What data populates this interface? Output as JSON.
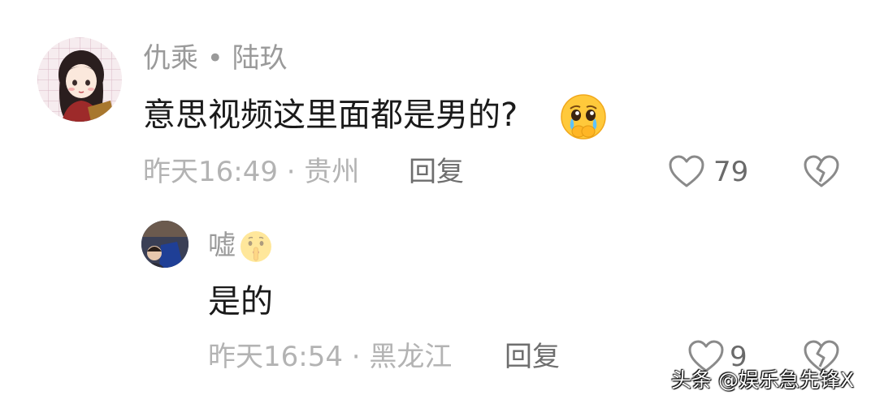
{
  "comment": {
    "author": "仇乘 • 陆玖",
    "text": "意思视频这里面都是男的?",
    "emoji_icon": "pleading-face-with-tears-icon",
    "time_location": "昨天16:49 · 贵州",
    "reply_label": "回复",
    "like_count": "79"
  },
  "reply": {
    "author": "嘘",
    "author_emoji_icon": "shushing-face-icon",
    "text": "是的",
    "time_location": "昨天16:54 · 黑龙江",
    "reply_label": "回复",
    "like_count": "9"
  },
  "watermark": "头条 @娱乐急先锋X"
}
